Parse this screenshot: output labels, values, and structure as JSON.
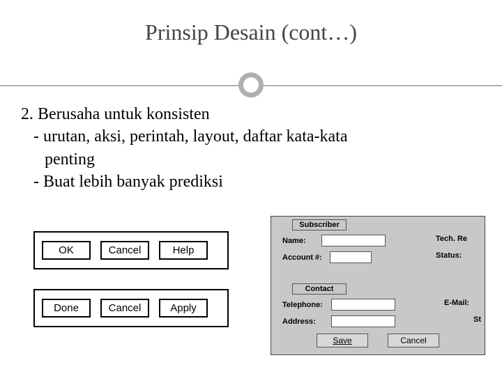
{
  "title": "Prinsip Desain (cont…)",
  "bullet": {
    "heading": "2. Berusaha untuk konsisten",
    "sub1a": "- urutan, aksi, perintah, layout, daftar kata-kata",
    "sub1b": "penting",
    "sub2": "- Buat lebih banyak prediksi"
  },
  "button_set_1": {
    "b1": "OK",
    "b2": "Cancel",
    "b3": "Help"
  },
  "button_set_2": {
    "b1": "Done",
    "b2": "Cancel",
    "b3": "Apply"
  },
  "dialog": {
    "section_subscriber": "Subscriber",
    "section_contact": "Contact",
    "name_label": "Name:",
    "account_label": "Account #:",
    "tech_label": "Tech. Re",
    "status_label": "Status:",
    "telephone_label": "Telephone:",
    "address_label": "Address:",
    "email_label": "E-Mail:",
    "st_label": "St",
    "save_btn": "Save",
    "cancel_btn": "Cancel"
  },
  "watermark": ""
}
